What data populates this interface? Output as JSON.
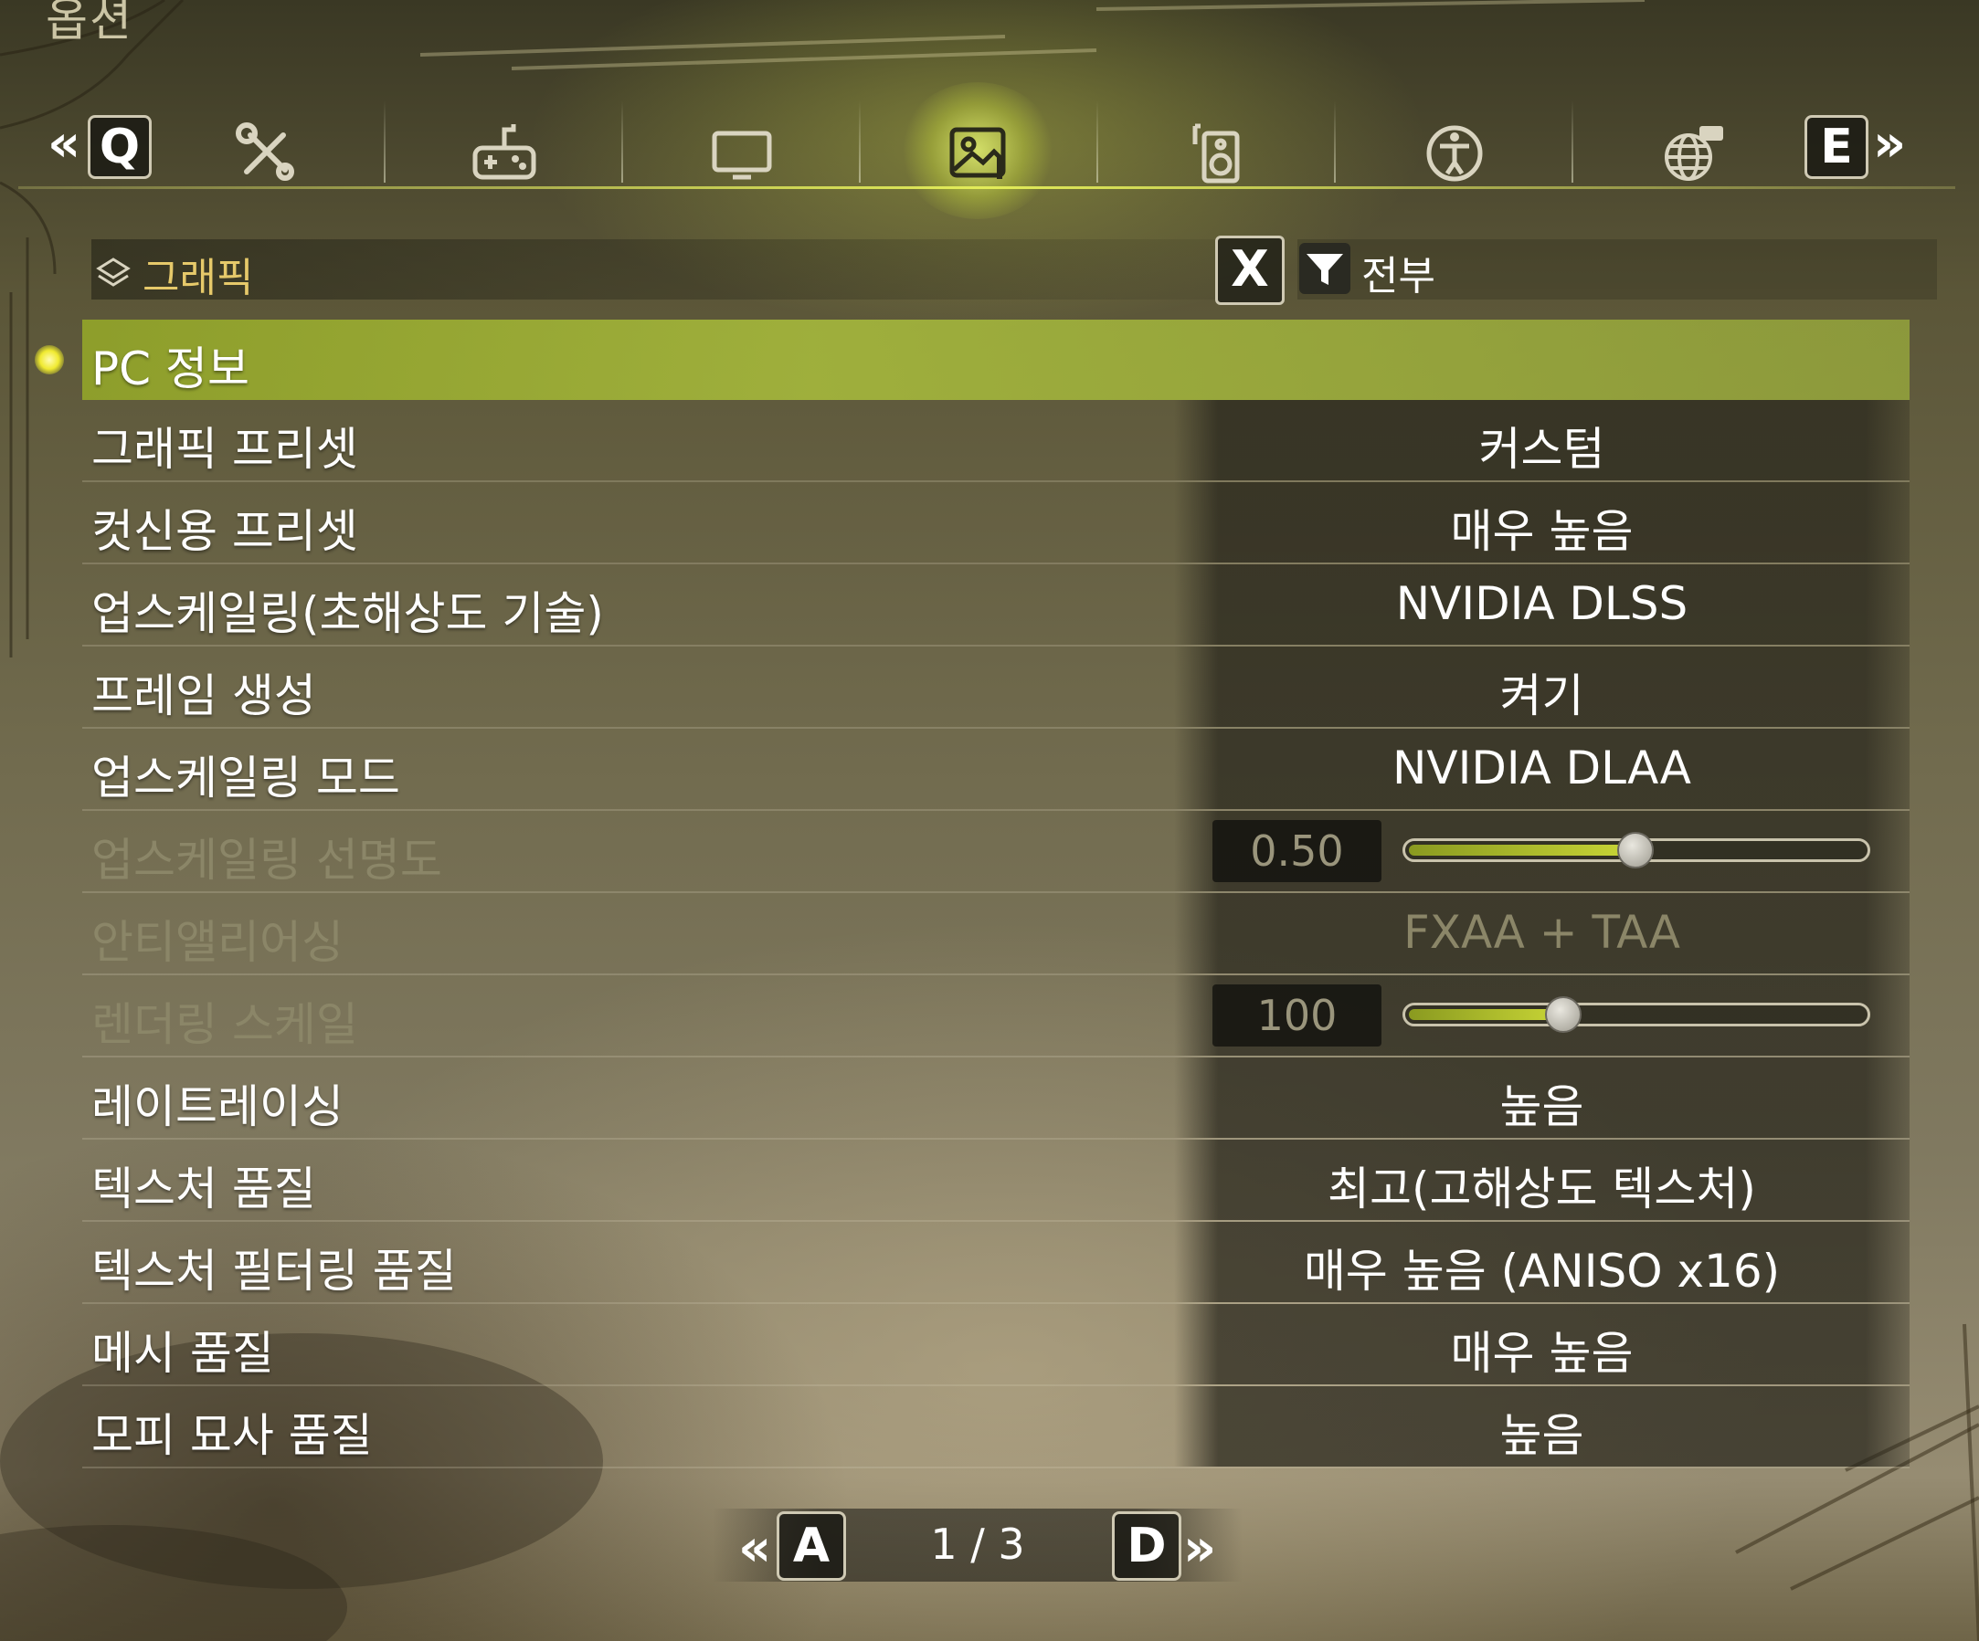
{
  "window": {
    "title": "옵션"
  },
  "tabs": {
    "prev_key": "Q",
    "next_key": "E",
    "items": [
      {
        "icon": "tools-icon"
      },
      {
        "icon": "gamepad-icon"
      },
      {
        "icon": "display-icon"
      },
      {
        "icon": "graphics-image-icon",
        "active": true
      },
      {
        "icon": "speaker-icon"
      },
      {
        "icon": "accessibility-icon"
      },
      {
        "icon": "globe-language-icon"
      }
    ]
  },
  "category": {
    "label": "그래픽"
  },
  "filter": {
    "key": "X",
    "label": "전부"
  },
  "settings": [
    {
      "label": "PC 정보",
      "value": "",
      "selected": true
    },
    {
      "label": "그래픽 프리셋",
      "value": "커스텀"
    },
    {
      "label": "컷신용 프리셋",
      "value": "매우 높음"
    },
    {
      "label": "업스케일링(초해상도 기술)",
      "value": "NVIDIA DLSS"
    },
    {
      "label": "프레임 생성",
      "value": "켜기"
    },
    {
      "label": "업스케일링 모드",
      "value": "NVIDIA DLAA"
    },
    {
      "label": "업스케일링 선명도",
      "value": "0.50",
      "disabled": true,
      "slider_fraction": 0.5
    },
    {
      "label": "안티앨리어싱",
      "value": "FXAA + TAA",
      "disabled": true
    },
    {
      "label": "렌더링 스케일",
      "value": "100",
      "disabled": true,
      "slider_fraction": 0.34
    },
    {
      "label": "레이트레이싱",
      "value": "높음"
    },
    {
      "label": "텍스처 품질",
      "value": "최고(고해상도 텍스처)"
    },
    {
      "label": "텍스처 필터링 품질",
      "value": "매우 높음 (ANISO x16)"
    },
    {
      "label": "메시 품질",
      "value": "매우 높음"
    },
    {
      "label": "모피 묘사 품질",
      "value": "높음"
    }
  ],
  "pager": {
    "prev_key": "A",
    "next_key": "D",
    "page": "1 / 3"
  },
  "colors": {
    "accent": "#c9d636",
    "selected_row": "#a4b83c",
    "category_text": "#e6c96a"
  }
}
